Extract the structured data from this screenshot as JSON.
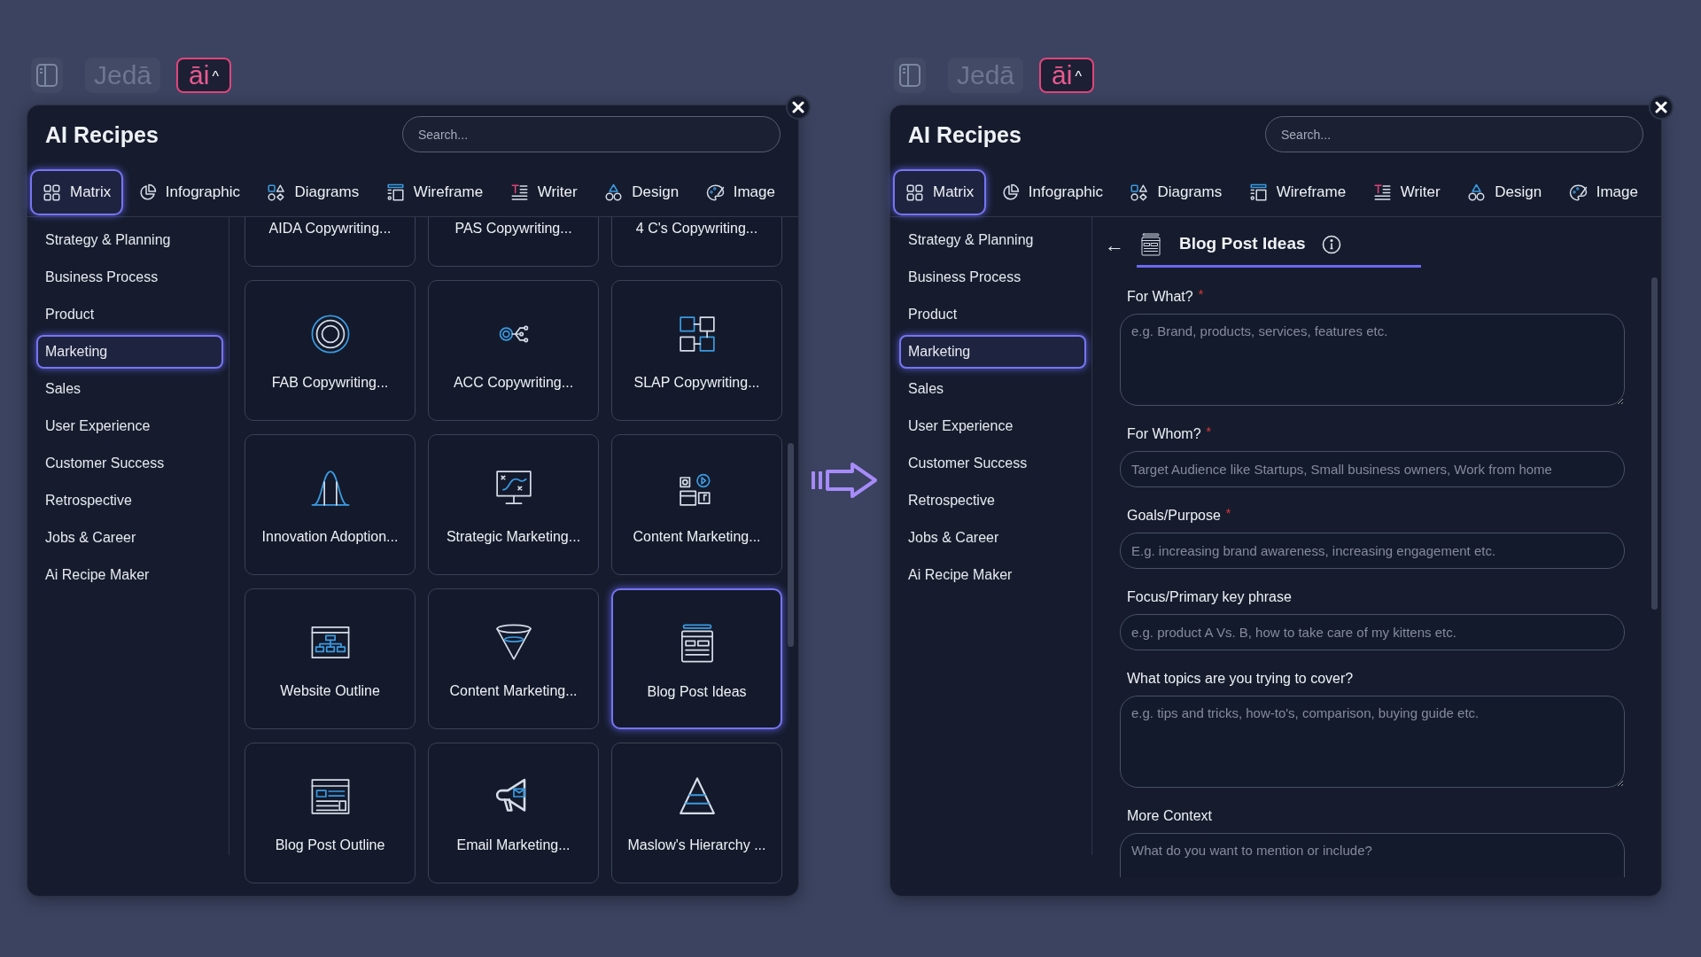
{
  "panels": [
    {
      "toolbar": {
        "brand": "Jedā",
        "ai_label": "āi",
        "caret": "^"
      },
      "title": "AI Recipes",
      "search": {
        "placeholder": "Search..."
      },
      "tabs": [
        {
          "label": "Matrix",
          "selected": true
        },
        {
          "label": "Infographic",
          "selected": false
        },
        {
          "label": "Diagrams",
          "selected": false
        },
        {
          "label": "Wireframe",
          "selected": false
        },
        {
          "label": "Writer",
          "selected": false
        },
        {
          "label": "Design",
          "selected": false
        },
        {
          "label": "Image",
          "selected": false
        }
      ],
      "categories": [
        {
          "label": "Strategy & Planning",
          "selected": false
        },
        {
          "label": "Business Process",
          "selected": false
        },
        {
          "label": "Product",
          "selected": false
        },
        {
          "label": "Marketing",
          "selected": true
        },
        {
          "label": "Sales",
          "selected": false
        },
        {
          "label": "User Experience",
          "selected": false
        },
        {
          "label": "Customer Success",
          "selected": false
        },
        {
          "label": "Retrospective",
          "selected": false
        },
        {
          "label": "Jobs & Career",
          "selected": false
        },
        {
          "label": "Ai Recipe Maker",
          "selected": false
        }
      ],
      "content": {
        "kind": "grid",
        "cards": [
          {
            "label": "AIDA Copywriting...",
            "selected": false
          },
          {
            "label": "PAS Copywriting...",
            "selected": false
          },
          {
            "label": "4 C's Copywriting...",
            "selected": false
          },
          {
            "label": "FAB Copywriting...",
            "selected": false
          },
          {
            "label": "ACC Copywriting...",
            "selected": false
          },
          {
            "label": "SLAP Copywriting...",
            "selected": false
          },
          {
            "label": "Innovation Adoption...",
            "selected": false
          },
          {
            "label": "Strategic Marketing...",
            "selected": false
          },
          {
            "label": "Content Marketing...",
            "selected": false
          },
          {
            "label": "Website Outline",
            "selected": false
          },
          {
            "label": "Content Marketing...",
            "selected": false
          },
          {
            "label": "Blog Post Ideas",
            "selected": true
          },
          {
            "label": "Blog Post Outline",
            "selected": false
          },
          {
            "label": "Email Marketing...",
            "selected": false
          },
          {
            "label": "Maslow's Hierarchy ...",
            "selected": false
          }
        ]
      }
    },
    {
      "toolbar": {
        "brand": "Jedā",
        "ai_label": "āi",
        "caret": "^"
      },
      "title": "AI Recipes",
      "search": {
        "placeholder": "Search..."
      },
      "tabs": [
        {
          "label": "Matrix",
          "selected": true
        },
        {
          "label": "Infographic",
          "selected": false
        },
        {
          "label": "Diagrams",
          "selected": false
        },
        {
          "label": "Wireframe",
          "selected": false
        },
        {
          "label": "Writer",
          "selected": false
        },
        {
          "label": "Design",
          "selected": false
        },
        {
          "label": "Image",
          "selected": false
        }
      ],
      "categories": [
        {
          "label": "Strategy & Planning",
          "selected": false
        },
        {
          "label": "Business Process",
          "selected": false
        },
        {
          "label": "Product",
          "selected": false
        },
        {
          "label": "Marketing",
          "selected": true
        },
        {
          "label": "Sales",
          "selected": false
        },
        {
          "label": "User Experience",
          "selected": false
        },
        {
          "label": "Customer Success",
          "selected": false
        },
        {
          "label": "Retrospective",
          "selected": false
        },
        {
          "label": "Jobs & Career",
          "selected": false
        },
        {
          "label": "Ai Recipe Maker",
          "selected": false
        }
      ],
      "content": {
        "kind": "form",
        "back": "←",
        "title": "Blog Post Ideas",
        "fields": [
          {
            "kind": "textarea",
            "label": "For What?",
            "required_mark": "*",
            "placeholder": "e.g. Brand, products, services, features etc."
          },
          {
            "kind": "input",
            "label": "For Whom?",
            "required_mark": "*",
            "placeholder": "Target Audience like Startups, Small business owners, Work from home"
          },
          {
            "kind": "input",
            "label": "Goals/Purpose",
            "required_mark": "*",
            "placeholder": "E.g. increasing brand awareness, increasing engagement etc."
          },
          {
            "kind": "input",
            "label": "Focus/Primary key phrase",
            "placeholder": "e.g. product A Vs. B, how to take care of my kittens etc."
          },
          {
            "kind": "textarea",
            "label": "What topics are you trying to cover?",
            "placeholder": "e.g. tips and tricks, how-to's, comparison, buying guide etc."
          },
          {
            "kind": "textarea",
            "label": "More Context",
            "placeholder": "What do you want to mention or include?"
          }
        ]
      }
    }
  ]
}
